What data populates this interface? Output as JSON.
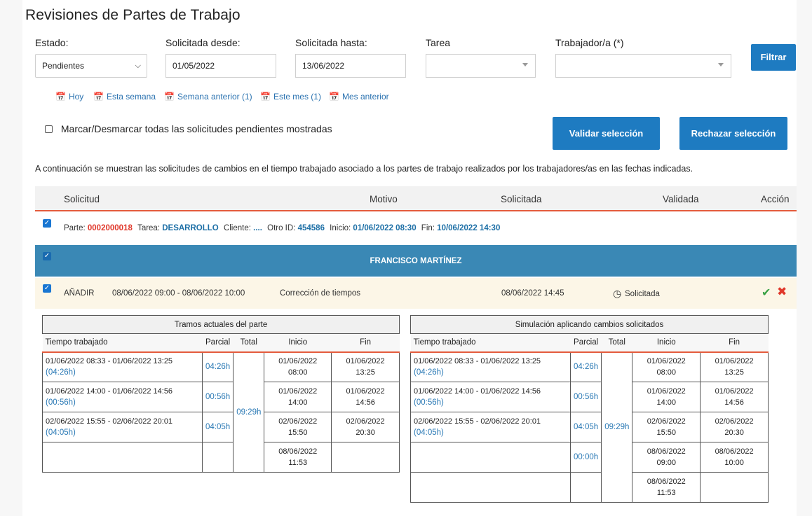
{
  "page_title": "Revisiones de Partes de Trabajo",
  "filters": {
    "estado_label": "Estado:",
    "estado_value": "Pendientes",
    "desde_label": "Solicitada desde:",
    "desde_value": "01/05/2022",
    "hasta_label": "Solicitada hasta:",
    "hasta_value": "13/06/2022",
    "tarea_label": "Tarea",
    "trabajador_label": "Trabajador/a (*)",
    "filtrar_label": "Filtrar"
  },
  "quick_ranges": [
    "Hoy",
    "Esta semana",
    "Semana anterior (1)",
    "Este mes (1)",
    "Mes anterior"
  ],
  "select_all_label": "Marcar/Desmarcar todas las solicitudes pendientes mostradas",
  "validar_label": "Validar selección",
  "rechazar_label": "Rechazar selección",
  "intro_text": "A continuación se muestran las solicitudes de cambios en el tiempo trabajado asociado a los partes de trabajo realizados por los trabajadores/as en las fechas indicadas.",
  "columns": {
    "solicitud": "Solicitud",
    "motivo": "Motivo",
    "solicitada": "Solicitada",
    "validada": "Validada",
    "accion": "Acción"
  },
  "part": {
    "parte_label": "Parte:",
    "parte_value": "0002000018",
    "tarea_label": "Tarea:",
    "tarea_value": "DESARROLLO",
    "cliente_label": "Cliente:",
    "cliente_value": "....",
    "otro_label": "Otro ID:",
    "otro_value": "454586",
    "inicio_label": "Inicio:",
    "inicio_value": "01/06/2022 08:30",
    "fin_label": "Fin:",
    "fin_value": "10/06/2022 14:30"
  },
  "worker_name": "FRANCISCO MARTÍNEZ",
  "request": {
    "type": "AÑADIR",
    "range": "08/06/2022 09:00 - 08/06/2022 10:00",
    "motivo": "Corrección de tiempos",
    "solicitada": "08/06/2022 14:45",
    "estado": "Solicitada"
  },
  "sub_headers": {
    "tiempo": "Tiempo trabajado",
    "parcial": "Parcial",
    "total": "Total",
    "inicio": "Inicio",
    "fin": "Fin"
  },
  "current": {
    "caption": "Tramos actuales del parte",
    "total": "09:29h",
    "rows": [
      {
        "range": "01/06/2022 08:33 - 01/06/2022 13:25",
        "dur": "(04:26h)",
        "parcial": "04:26h",
        "ini_d": "01/06/2022",
        "ini_t": "08:00",
        "fin_d": "01/06/2022",
        "fin_t": "13:25"
      },
      {
        "range": "01/06/2022 14:00 - 01/06/2022 14:56",
        "dur": "(00:56h)",
        "parcial": "00:56h",
        "ini_d": "01/06/2022",
        "ini_t": "14:00",
        "fin_d": "01/06/2022",
        "fin_t": "14:56"
      },
      {
        "range": "02/06/2022 15:55 - 02/06/2022 20:01",
        "dur": "(04:05h)",
        "parcial": "04:05h",
        "ini_d": "02/06/2022",
        "ini_t": "15:50",
        "fin_d": "02/06/2022",
        "fin_t": "20:30"
      },
      {
        "range": "",
        "dur": "",
        "parcial": "",
        "ini_d": "08/06/2022",
        "ini_t": "11:53",
        "fin_d": "",
        "fin_t": ""
      }
    ]
  },
  "simulation": {
    "caption": "Simulación aplicando cambios solicitados",
    "total": "09:29h",
    "rows": [
      {
        "range": "01/06/2022 08:33 - 01/06/2022 13:25",
        "dur": "(04:26h)",
        "parcial": "04:26h",
        "ini_d": "01/06/2022",
        "ini_t": "08:00",
        "fin_d": "01/06/2022",
        "fin_t": "13:25"
      },
      {
        "range": "01/06/2022 14:00 - 01/06/2022 14:56",
        "dur": "(00:56h)",
        "parcial": "00:56h",
        "ini_d": "01/06/2022",
        "ini_t": "14:00",
        "fin_d": "01/06/2022",
        "fin_t": "14:56"
      },
      {
        "range": "02/06/2022 15:55 - 02/06/2022 20:01",
        "dur": "(04:05h)",
        "parcial": "04:05h",
        "ini_d": "02/06/2022",
        "ini_t": "15:50",
        "fin_d": "02/06/2022",
        "fin_t": "20:30"
      },
      {
        "range": "",
        "dur": "",
        "parcial": "00:00h",
        "ini_d": "08/06/2022",
        "ini_t": "09:00",
        "fin_d": "08/06/2022",
        "fin_t": "10:00"
      },
      {
        "range": "",
        "dur": "",
        "parcial": "",
        "ini_d": "08/06/2022",
        "ini_t": "11:53",
        "fin_d": "",
        "fin_t": ""
      }
    ]
  }
}
